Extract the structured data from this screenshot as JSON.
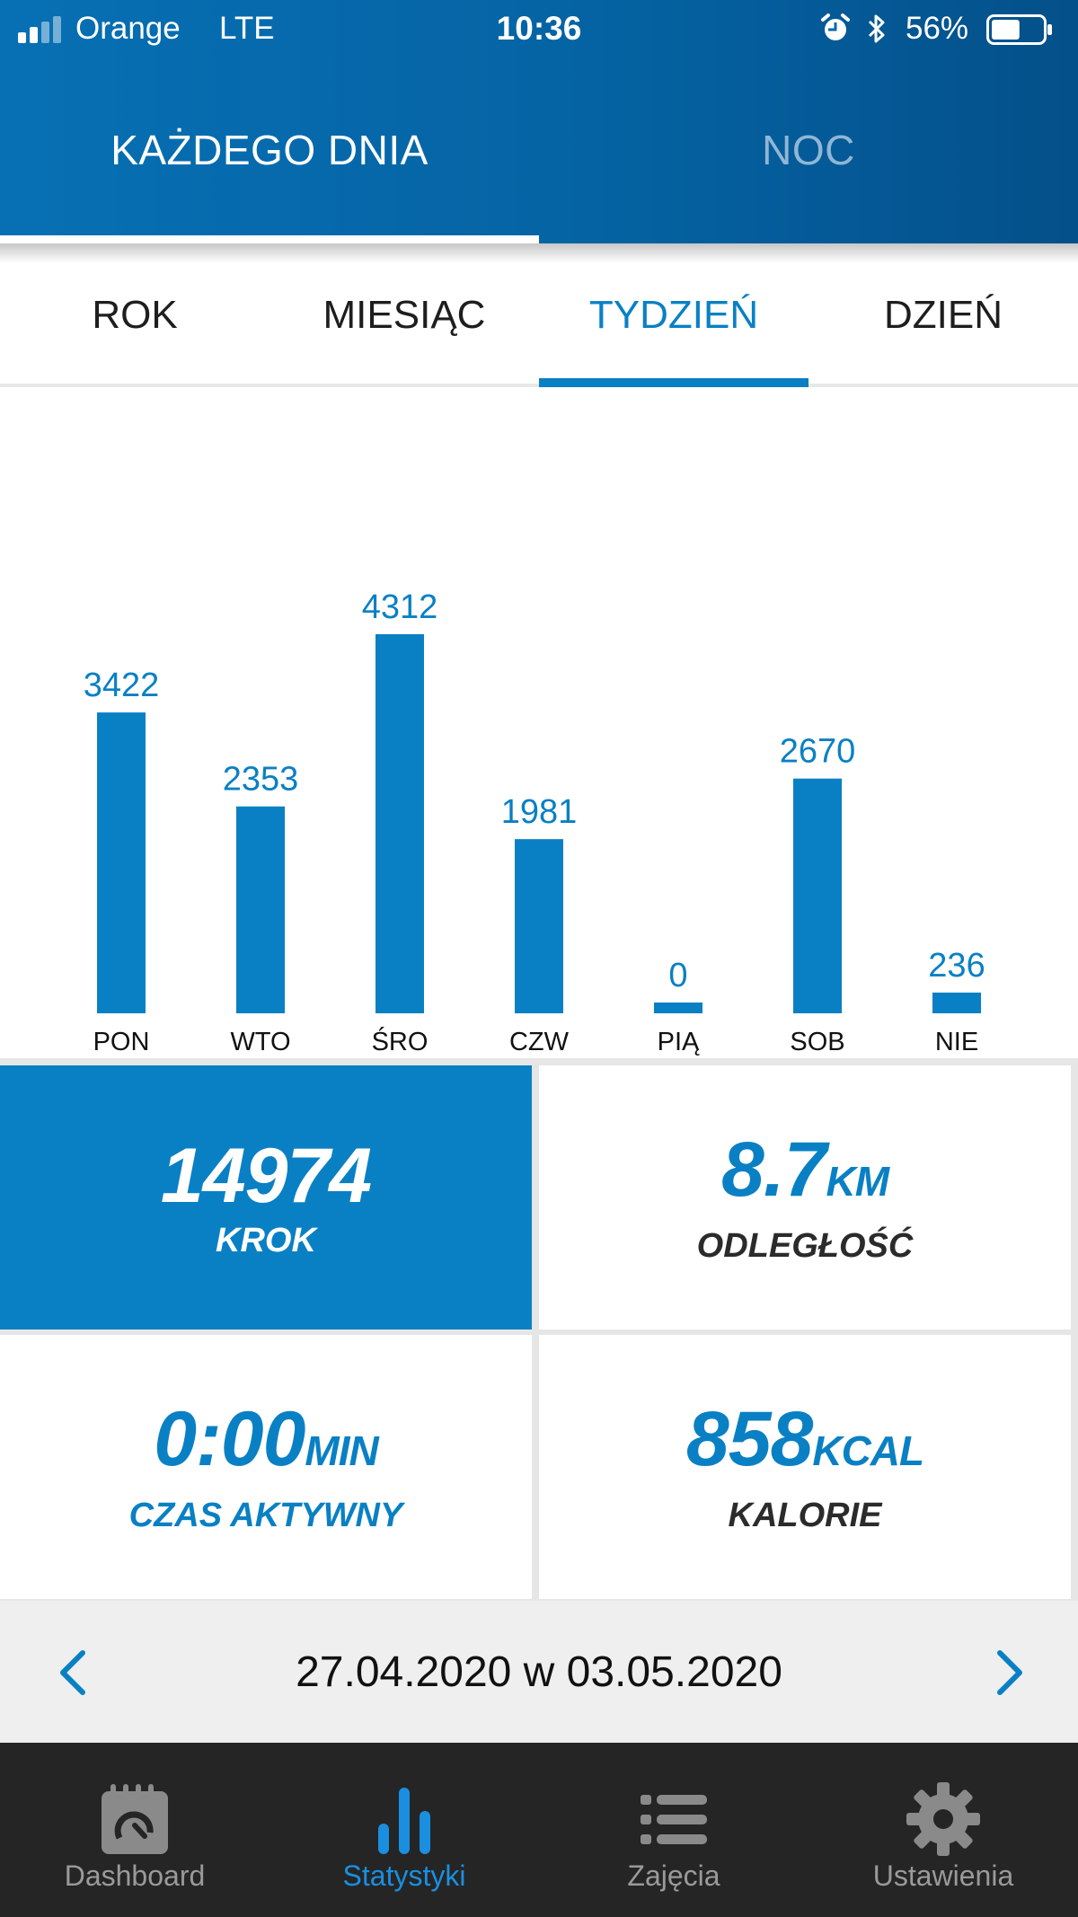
{
  "status_bar": {
    "carrier": "Orange",
    "network": "LTE",
    "time": "10:36",
    "battery": "56%",
    "battery_level": 0.56
  },
  "top_tabs": [
    {
      "label": "KAŻDEGO DNIA",
      "active": true
    },
    {
      "label": "NOC",
      "active": false
    }
  ],
  "period_tabs": [
    {
      "label": "ROK",
      "active": false
    },
    {
      "label": "MIESIĄC",
      "active": false
    },
    {
      "label": "TYDZIEŃ",
      "active": true
    },
    {
      "label": "DZIEŃ",
      "active": false
    }
  ],
  "colors": {
    "accent": "#0a80c4",
    "header_start": "#0770b4",
    "header_end": "#04508a",
    "nav_background": "#252526",
    "nav_active": "#1a8fe0"
  },
  "chart_data": {
    "type": "bar",
    "categories": [
      "PON",
      "WTO",
      "ŚRO",
      "CZW",
      "PIĄ",
      "SOB",
      "NIE"
    ],
    "values": [
      3422,
      2353,
      4312,
      1981,
      0,
      2670,
      236
    ],
    "data_labels": [
      "3422",
      "2353",
      "4312",
      "1981",
      "0",
      "2670",
      "236"
    ],
    "title": "",
    "xlabel": "",
    "ylabel": "",
    "ylim": [
      0,
      4312
    ],
    "grid": false,
    "color": "#0a80c4"
  },
  "stats": {
    "steps": {
      "value": "14974",
      "unit": "",
      "label": "KROK"
    },
    "distance": {
      "value": "8.7",
      "unit": "KM",
      "label": "ODLEGŁOŚĆ"
    },
    "active_time": {
      "value": "0:00",
      "unit": "MIN",
      "label": "CZAS AKTYWNY"
    },
    "calories": {
      "value": "858",
      "unit": "KCAL",
      "label": "KALORIE"
    }
  },
  "date_range": {
    "text": "27.04.2020 w 03.05.2020",
    "prev_icon": "chevron-left-icon",
    "next_icon": "chevron-right-icon"
  },
  "bottom_nav": [
    {
      "label": "Dashboard",
      "icon": "notepad-gauge-icon",
      "active": false
    },
    {
      "label": "Statystyki",
      "icon": "bar-chart-icon",
      "active": true
    },
    {
      "label": "Zajęcia",
      "icon": "list-icon",
      "active": false
    },
    {
      "label": "Ustawienia",
      "icon": "gear-icon",
      "active": false
    }
  ]
}
